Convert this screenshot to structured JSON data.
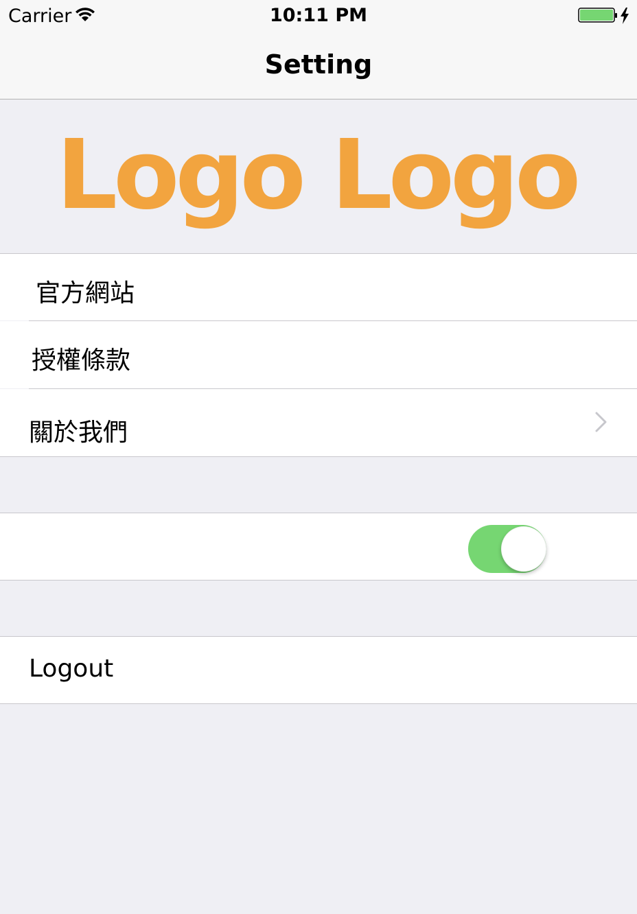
{
  "status_bar": {
    "carrier": "Carrier",
    "time": "10:11 PM",
    "wifi_icon": "wifi-icon",
    "battery_icon": "battery-charging-icon",
    "battery_color": "#76d672"
  },
  "nav": {
    "title": "Setting"
  },
  "logo": {
    "text": "Logo Logo",
    "color": "#f2a43f"
  },
  "menu": {
    "items": [
      {
        "label": "官方網站"
      },
      {
        "label": "授權條款"
      },
      {
        "label": "關於我們",
        "accessory": "chevron-right-icon"
      }
    ]
  },
  "toggle": {
    "on": true,
    "color": "#76d672"
  },
  "logout": {
    "label": "Logout"
  }
}
